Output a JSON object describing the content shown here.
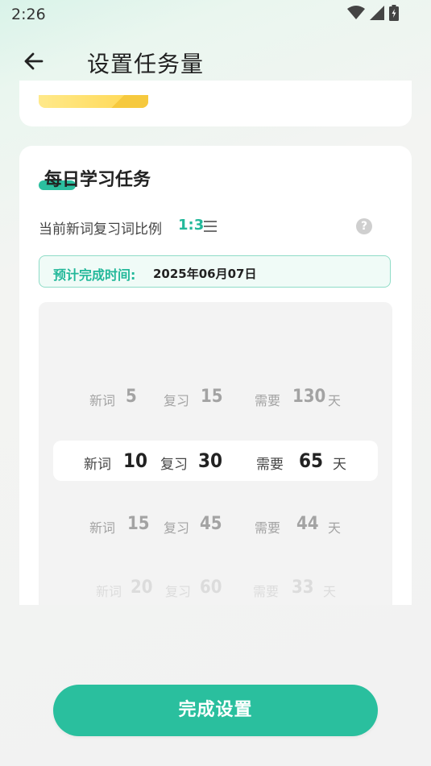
{
  "status_bar": {
    "time": "2:26"
  },
  "header": {
    "title": "设置任务量"
  },
  "section": {
    "title": "每日学习任务",
    "ratio_label": "当前新词复习词比例",
    "ratio_value": "1:3",
    "help_symbol": "?"
  },
  "estimate": {
    "label": "预计完成时间:",
    "value": "2025年06月07日"
  },
  "picker": {
    "rows": [
      {
        "new_label": "新词",
        "new_count": "5",
        "review_label": "复习",
        "review_count": "15",
        "need_label": "需要",
        "days": "130",
        "unit": "天"
      },
      {
        "new_label": "新词",
        "new_count": "10",
        "review_label": "复习",
        "review_count": "30",
        "need_label": "需要",
        "days": "65",
        "unit": "天"
      },
      {
        "new_label": "新词",
        "new_count": "15",
        "review_label": "复习",
        "review_count": "45",
        "need_label": "需要",
        "days": "44",
        "unit": "天"
      },
      {
        "new_label": "新词",
        "new_count": "20",
        "review_label": "复习",
        "review_count": "60",
        "need_label": "需要",
        "days": "33",
        "unit": "天"
      }
    ],
    "selected_index": 1
  },
  "footer": {
    "done_label": "完成设置"
  },
  "colors": {
    "accent": "#2abf9e",
    "accent_text": "#23b89a"
  }
}
